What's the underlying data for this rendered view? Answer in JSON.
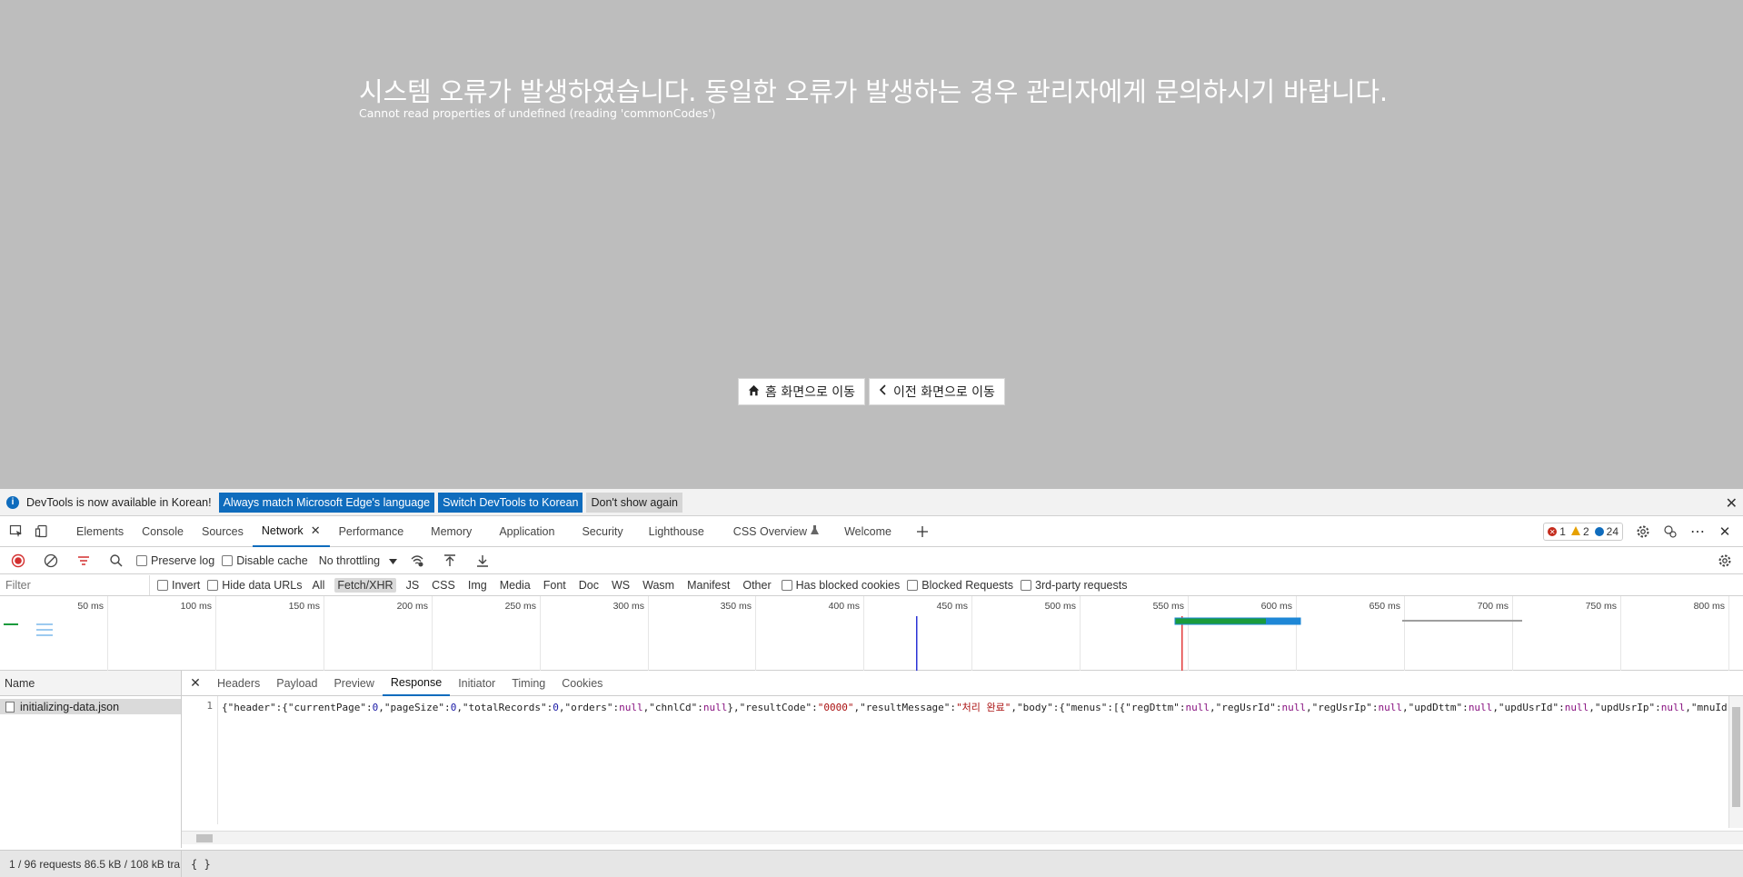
{
  "page": {
    "error_title": "시스템 오류가 발생하였습니다. 동일한 오류가 발생하는 경우 관리자에게 문의하시기 바랍니다.",
    "error_detail": "Cannot read properties of undefined (reading 'commonCodes')",
    "home_button": "홈 화면으로 이동",
    "back_button": "이전 화면으로 이동"
  },
  "infobar": {
    "message": "DevTools is now available in Korean!",
    "btn_match": "Always match Microsoft Edge's language",
    "btn_switch": "Switch DevTools to Korean",
    "btn_dont_show": "Don't show again",
    "close": "✕"
  },
  "tabs": [
    "Elements",
    "Console",
    "Sources",
    "Network",
    "Performance",
    "Memory",
    "Application",
    "Security",
    "Lighthouse",
    "CSS Overview",
    "Welcome"
  ],
  "badges": {
    "errors": "1",
    "warnings": "2",
    "messages": "24"
  },
  "toolbar": {
    "preserve_log": "Preserve log",
    "disable_cache": "Disable cache",
    "throttling": "No throttling"
  },
  "filter": {
    "placeholder": "Filter",
    "invert": "Invert",
    "hide_data_urls": "Hide data URLs",
    "types": [
      "All",
      "Fetch/XHR",
      "JS",
      "CSS",
      "Img",
      "Media",
      "Font",
      "Doc",
      "WS",
      "Wasm",
      "Manifest",
      "Other"
    ],
    "active_type": "Fetch/XHR",
    "has_blocked_cookies": "Has blocked cookies",
    "blocked_requests": "Blocked Requests",
    "third_party": "3rd-party requests"
  },
  "timeline": {
    "ticks": [
      "50 ms",
      "100 ms",
      "150 ms",
      "200 ms",
      "250 ms",
      "300 ms",
      "350 ms",
      "400 ms",
      "450 ms",
      "500 ms",
      "550 ms",
      "600 ms",
      "650 ms",
      "700 ms",
      "750 ms",
      "800 ms"
    ]
  },
  "request_list": {
    "header": "Name",
    "rows": [
      "initializing-data.json"
    ]
  },
  "detail": {
    "tabs": [
      "Headers",
      "Payload",
      "Preview",
      "Response",
      "Initiator",
      "Timing",
      "Cookies"
    ],
    "active_tab": "Response",
    "line_number": "1"
  },
  "status": {
    "summary": "1 / 96 requests  86.5 kB / 108 kB tra",
    "pretty_print": "{ }"
  },
  "colors": {
    "accent": "#0f6cbd",
    "page_background": "#bdbdbd"
  }
}
